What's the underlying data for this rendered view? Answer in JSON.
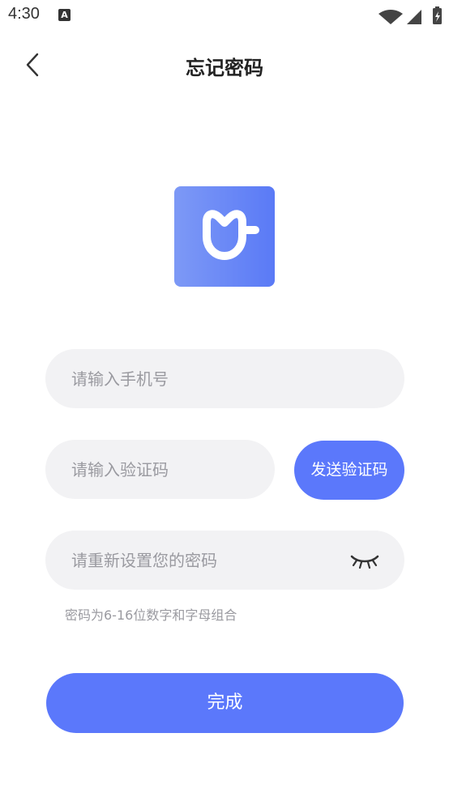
{
  "status_bar": {
    "time": "4:30",
    "notification_letter": "A",
    "icons": [
      "wifi-icon",
      "cellular-signal-icon",
      "battery-charging-icon"
    ]
  },
  "header": {
    "title": "忘记密码",
    "back_icon": "chevron-left-icon"
  },
  "logo": {
    "icon": "app-logo-icon",
    "colors": {
      "gradient_start": "#7d99f6",
      "gradient_end": "#5a7af6"
    }
  },
  "form": {
    "phone": {
      "placeholder": "请输入手机号",
      "value": ""
    },
    "code": {
      "placeholder": "请输入验证码",
      "value": ""
    },
    "send_code_label": "发送验证码",
    "password": {
      "placeholder": "请重新设置您的密码",
      "value": ""
    },
    "password_toggle_icon": "eye-closed-icon",
    "hint": "密码为6-16位数字和字母组合",
    "submit_label": "完成"
  },
  "colors": {
    "accent": "#5b78fb",
    "field_bg": "#f2f2f4",
    "placeholder": "#9a9aa0"
  }
}
